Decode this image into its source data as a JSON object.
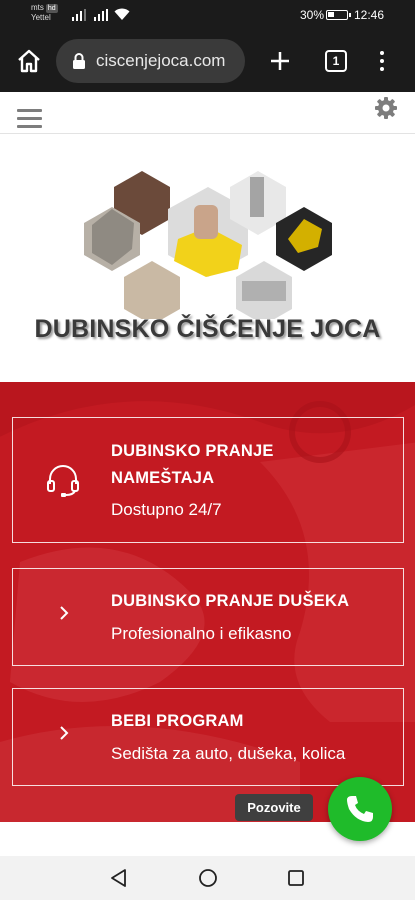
{
  "status_bar": {
    "carrier_line1": "mts",
    "carrier_badge": "hd",
    "carrier_line2": "Yettel",
    "battery_percent": "30%",
    "battery_level": 0.3,
    "time": "12:46"
  },
  "browser": {
    "url": "ciscenjejoca.com",
    "tab_count": "1"
  },
  "logo": {
    "title": "DUBINSKO ČIŠĆENJE JOCA"
  },
  "cards": [
    {
      "title": "DUBINSKO PRANJE NAMEŠTAJA",
      "subtitle": "Dostupno 24/7",
      "icon": "headset-icon"
    },
    {
      "title": "DUBINSKO PRANJE DUŠEKA",
      "subtitle": "Profesionalno i efikasno",
      "icon": "chevron-right-icon"
    },
    {
      "title": "BEBI PROGRAM",
      "subtitle": "Sedišta za auto, dušeka, kolica",
      "icon": "chevron-right-icon"
    }
  ],
  "call": {
    "tooltip": "Pozovite",
    "icon": "phone-icon",
    "color": "#1fbb2a"
  },
  "colors": {
    "accent_red": "#c31a22",
    "browser_bg": "#1b1b1b"
  }
}
